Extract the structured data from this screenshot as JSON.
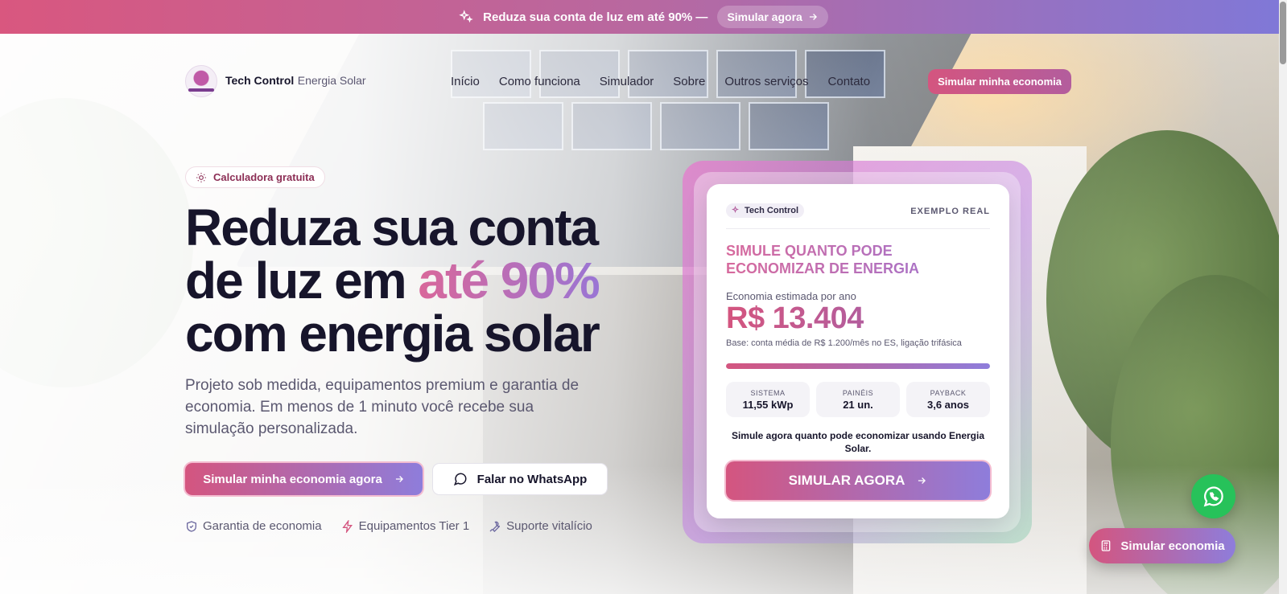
{
  "announcement": {
    "text": "Reduza sua conta de luz em até 90% —",
    "cta_label": "Simular agora",
    "icon": "sparkles-icon"
  },
  "nav": {
    "brand_strong": "Tech Control",
    "brand_light": "Energia Solar",
    "links": [
      "Início",
      "Como funciona",
      "Simulador",
      "Sobre",
      "Outros serviços",
      "Contato"
    ],
    "cta_label": "Simular minha economia"
  },
  "hero": {
    "badge_label": "Calculadora gratuita",
    "headline_line1": "Reduza sua conta",
    "headline_line2_prefix": "de luz em",
    "headline_highlight": "até 90%",
    "headline_line3": "com energia solar",
    "subtitle": "Projeto sob medida, equipamentos premium e garantia de economia. Em menos de 1 minuto você recebe sua simulação personalizada.",
    "primary_cta": "Simular minha economia agora",
    "secondary_cta": "Falar no WhatsApp",
    "trust_items": [
      {
        "label": "Garantia de economia",
        "icon": "shield-icon"
      },
      {
        "label": "Equipamentos Tier 1",
        "icon": "bolt-icon"
      },
      {
        "label": "Suporte vitalício",
        "icon": "wrench-icon"
      }
    ]
  },
  "card": {
    "badge_label": "Tech Control",
    "tag": "EXEMPLO REAL",
    "title": "SIMULE QUANTO PODE ECONOMIZAR DE ENERGIA",
    "estimate_label": "Economia estimada por ano",
    "estimate_value": "R$ 13.404",
    "base_note": "Base: conta média de R$ 1.200/mês no ES, ligação trifásica",
    "progress": 1.0,
    "stats": [
      {
        "label": "SISTEMA",
        "value": "11,55 kWp"
      },
      {
        "label": "PAINÉIS",
        "value": "21 un."
      },
      {
        "label": "PAYBACK",
        "value": "3,6 anos"
      }
    ],
    "note": "Simule agora quanto pode economizar usando Energia Solar.",
    "cta_label": "SIMULAR AGORA"
  },
  "floating": {
    "whatsapp_icon": "whatsapp-icon",
    "simulate_label": "Simular economia",
    "simulate_icon": "calculator-icon"
  },
  "colors": {
    "accent_pink": "#d4557f",
    "accent_purple": "#8e7ddb",
    "whatsapp_green": "#27c25a",
    "text_dark": "#17152b"
  }
}
